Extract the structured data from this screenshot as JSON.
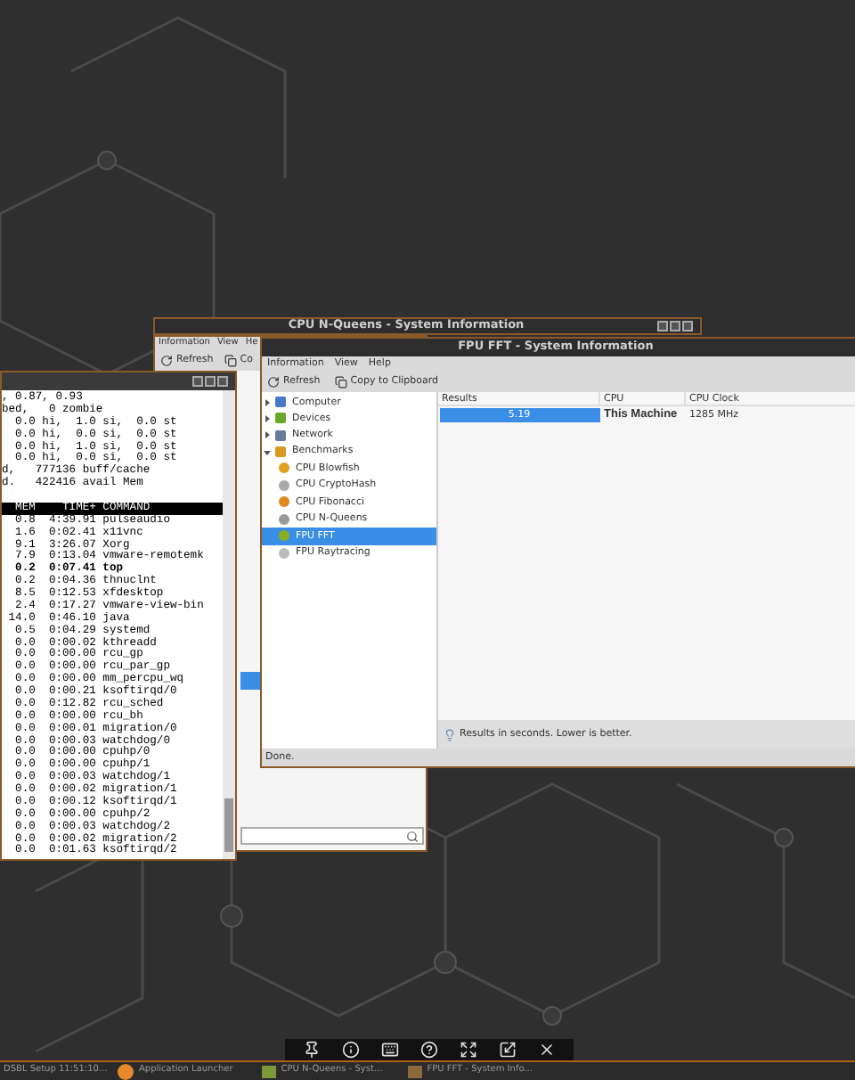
{
  "terminal": {
    "lines": [
      ", 0.87, 0.93",
      "bed,   0 zombie",
      "  0.0 hi,  1.0 si,  0.0 st",
      "  0.0 hi,  0.0 si,  0.0 st",
      "  0.0 hi,  1.0 si,  0.0 st",
      "  0.0 hi,  0.0 si,  0.0 st",
      "d,   777136 buff/cache",
      "d.   422416 avail Mem"
    ],
    "header": "  MEM    TIME+ COMMAND",
    "processes": [
      {
        "text": "  0.8  4:39.91 pulseaudio",
        "bold": false
      },
      {
        "text": "  1.6  0:02.41 x11vnc",
        "bold": false
      },
      {
        "text": "  9.1  3:26.07 Xorg",
        "bold": false
      },
      {
        "text": "  7.9  0:13.04 vmware-remotemk",
        "bold": false
      },
      {
        "text": "  0.2  0:07.41 top",
        "bold": true
      },
      {
        "text": "  0.2  0:04.36 thnuclnt",
        "bold": false
      },
      {
        "text": "  8.5  0:12.53 xfdesktop",
        "bold": false
      },
      {
        "text": "  2.4  0:17.27 vmware-view-bin",
        "bold": false
      },
      {
        "text": " 14.0  0:46.10 java",
        "bold": false
      },
      {
        "text": "  0.5  0:04.29 systemd",
        "bold": false
      },
      {
        "text": "  0.0  0:00.02 kthreadd",
        "bold": false
      },
      {
        "text": "  0.0  0:00.00 rcu_gp",
        "bold": false
      },
      {
        "text": "  0.0  0:00.00 rcu_par_gp",
        "bold": false
      },
      {
        "text": "  0.0  0:00.00 mm_percpu_wq",
        "bold": false
      },
      {
        "text": "  0.0  0:00.21 ksoftirqd/0",
        "bold": false
      },
      {
        "text": "  0.0  0:12.82 rcu_sched",
        "bold": false
      },
      {
        "text": "  0.0  0:00.00 rcu_bh",
        "bold": false
      },
      {
        "text": "  0.0  0:00.01 migration/0",
        "bold": false
      },
      {
        "text": "  0.0  0:00.03 watchdog/0",
        "bold": false
      },
      {
        "text": "  0.0  0:00.00 cpuhp/0",
        "bold": false
      },
      {
        "text": "  0.0  0:00.00 cpuhp/1",
        "bold": false
      },
      {
        "text": "  0.0  0:00.03 watchdog/1",
        "bold": false
      },
      {
        "text": "  0.0  0:00.02 migration/1",
        "bold": false
      },
      {
        "text": "  0.0  0:00.12 ksoftirqd/1",
        "bold": false
      },
      {
        "text": "  0.0  0:00.00 cpuhp/2",
        "bold": false
      },
      {
        "text": "  0.0  0:00.03 watchdog/2",
        "bold": false
      },
      {
        "text": "  0.0  0:00.02 migration/2",
        "bold": false
      },
      {
        "text": "  0.0  0:01.63 ksoftirqd/2",
        "bold": false
      }
    ]
  },
  "nqueens_window": {
    "title": "CPU N-Queens - System Information",
    "menu": [
      "Information",
      "View",
      "He"
    ],
    "toolbar": [
      "Refresh",
      "Co"
    ]
  },
  "fpu_window": {
    "title": "FPU FFT - System Information",
    "menu": [
      "Information",
      "View",
      "Help"
    ],
    "toolbar": [
      "Refresh",
      "Copy to Clipboard"
    ],
    "tree": [
      {
        "label": "Computer",
        "expanded": false,
        "selected": false
      },
      {
        "label": "Devices",
        "expanded": false,
        "selected": false
      },
      {
        "label": "Network",
        "expanded": false,
        "selected": false
      },
      {
        "label": "Benchmarks",
        "expanded": true,
        "selected": false,
        "children": [
          {
            "label": "CPU Blowfish",
            "selected": false
          },
          {
            "label": "CPU CryptoHash",
            "selected": false
          },
          {
            "label": "CPU Fibonacci",
            "selected": false
          },
          {
            "label": "CPU N-Queens",
            "selected": false
          },
          {
            "label": "FPU FFT",
            "selected": true
          },
          {
            "label": "FPU Raytracing",
            "selected": false
          }
        ]
      }
    ],
    "results": {
      "columns": [
        "Results",
        "CPU",
        "CPU Clock"
      ],
      "rows": [
        {
          "value": "5.19",
          "level": 1,
          "cpu": "This Machine",
          "clock": "1285 MHz"
        }
      ]
    },
    "note": "Results in seconds. Lower is better.",
    "status": "Done."
  },
  "taskbar": {
    "items": [
      "DSBL Setup 11:51:10...",
      "Application Launcher",
      "CPU N-Queens - Syst...",
      "FPU FFT - System Info..."
    ]
  }
}
